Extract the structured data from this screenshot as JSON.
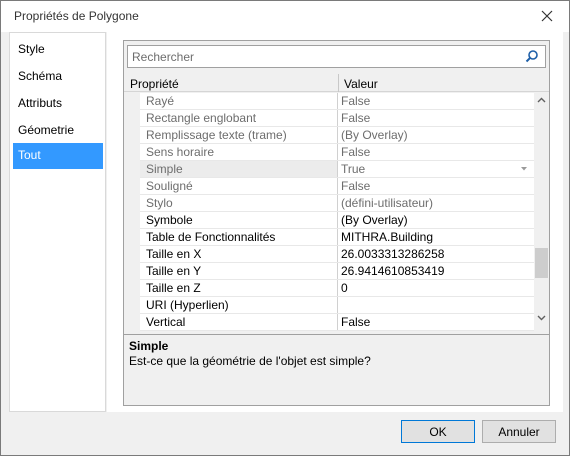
{
  "window": {
    "title": "Propriétés de Polygone"
  },
  "nav": {
    "items": [
      {
        "label": "Style",
        "active": false
      },
      {
        "label": "Schéma",
        "active": false
      },
      {
        "label": "Attributs",
        "active": false
      },
      {
        "label": "Géometrie",
        "active": false
      },
      {
        "label": "Tout",
        "active": true
      }
    ]
  },
  "search": {
    "placeholder": "Rechercher"
  },
  "grid": {
    "columns": [
      "Propriété",
      "Valeur"
    ],
    "rows": [
      {
        "name": "Rayé",
        "value": "False"
      },
      {
        "name": "Rectangle englobant",
        "value": "False"
      },
      {
        "name": "Remplissage texte (trame)",
        "value": " (By Overlay)"
      },
      {
        "name": "Sens horaire",
        "value": "False"
      },
      {
        "name": "Simple",
        "value": "True"
      },
      {
        "name": "Souligné",
        "value": "False"
      },
      {
        "name": "Stylo",
        "value": " (défini-utilisateur)"
      },
      {
        "name": "Symbole",
        "value": " (By Overlay)"
      },
      {
        "name": "Table de Fonctionnalités",
        "value": "MITHRA.Building"
      },
      {
        "name": "Taille en X",
        "value": "26.0033313286258"
      },
      {
        "name": "Taille en Y",
        "value": "26.9414610853419"
      },
      {
        "name": "Taille en Z",
        "value": "0"
      },
      {
        "name": "URI (Hyperlien)",
        "value": ""
      },
      {
        "name": "Vertical",
        "value": "False"
      }
    ]
  },
  "description": {
    "title": "Simple",
    "text": "Est-ce que la géométrie de l'objet est simple?"
  },
  "buttons": {
    "ok": "OK",
    "cancel": "Annuler"
  }
}
